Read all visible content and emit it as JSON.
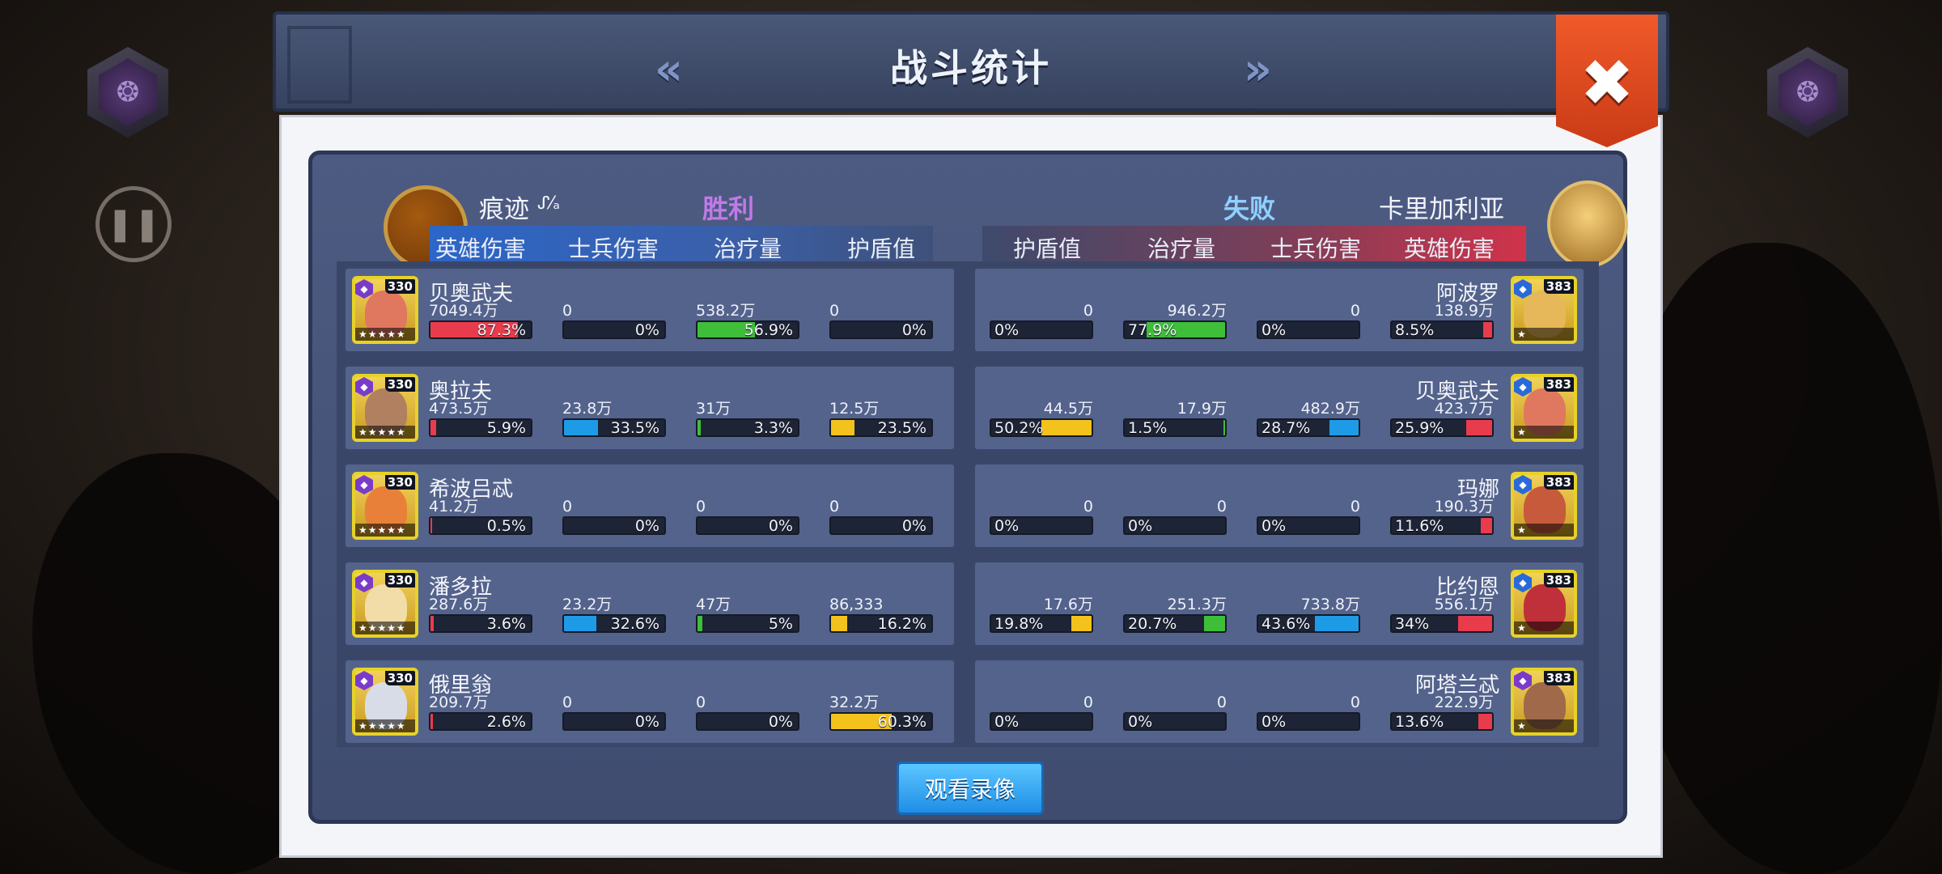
{
  "title": "战斗统计",
  "nav": {
    "prev_icon": "«",
    "next_icon": "»",
    "close_icon": "✖"
  },
  "left_side": {
    "player": "痕迹",
    "player_mark": "ᔑ⁄ₐ",
    "result": "胜利",
    "result_color": "#c07ae8",
    "columns": [
      "英雄伤害",
      "士兵伤害",
      "治疗量",
      "护盾值"
    ]
  },
  "right_side": {
    "player": "卡里加利亚",
    "result": "失败",
    "result_color": "#8fd0ff",
    "columns": [
      "护盾值",
      "治疗量",
      "士兵伤害",
      "英雄伤害"
    ]
  },
  "left_heroes": [
    {
      "name": "贝奥武夫",
      "level": "330",
      "face": "#e07860",
      "stats": [
        {
          "value": "7049.4万",
          "pct": "87.3%",
          "fill": 0.873,
          "color": "#e83c4c"
        },
        {
          "value": "0",
          "pct": "0%",
          "fill": 0,
          "color": "#1e9be6"
        },
        {
          "value": "538.2万",
          "pct": "56.9%",
          "fill": 0.569,
          "color": "#3fbe3a"
        },
        {
          "value": "0",
          "pct": "0%",
          "fill": 0,
          "color": "#f3c21c"
        }
      ]
    },
    {
      "name": "奥拉夫",
      "level": "330",
      "face": "#b08060",
      "stats": [
        {
          "value": "473.5万",
          "pct": "5.9%",
          "fill": 0.059,
          "color": "#e83c4c"
        },
        {
          "value": "23.8万",
          "pct": "33.5%",
          "fill": 0.335,
          "color": "#1e9be6"
        },
        {
          "value": "31万",
          "pct": "3.3%",
          "fill": 0.033,
          "color": "#3fbe3a"
        },
        {
          "value": "12.5万",
          "pct": "23.5%",
          "fill": 0.235,
          "color": "#f3c21c"
        }
      ]
    },
    {
      "name": "希波吕忒",
      "level": "330",
      "face": "#e8803a",
      "stats": [
        {
          "value": "41.2万",
          "pct": "0.5%",
          "fill": 0.005,
          "color": "#e83c4c"
        },
        {
          "value": "0",
          "pct": "0%",
          "fill": 0,
          "color": "#1e9be6"
        },
        {
          "value": "0",
          "pct": "0%",
          "fill": 0,
          "color": "#3fbe3a"
        },
        {
          "value": "0",
          "pct": "0%",
          "fill": 0,
          "color": "#f3c21c"
        }
      ]
    },
    {
      "name": "潘多拉",
      "level": "330",
      "face": "#f2dca8",
      "stats": [
        {
          "value": "287.6万",
          "pct": "3.6%",
          "fill": 0.036,
          "color": "#e83c4c"
        },
        {
          "value": "23.2万",
          "pct": "32.6%",
          "fill": 0.326,
          "color": "#1e9be6"
        },
        {
          "value": "47万",
          "pct": "5%",
          "fill": 0.05,
          "color": "#3fbe3a"
        },
        {
          "value": "86,333",
          "pct": "16.2%",
          "fill": 0.162,
          "color": "#f3c21c"
        }
      ]
    },
    {
      "name": "俄里翁",
      "level": "330",
      "face": "#d8dce6",
      "stats": [
        {
          "value": "209.7万",
          "pct": "2.6%",
          "fill": 0.026,
          "color": "#e83c4c"
        },
        {
          "value": "0",
          "pct": "0%",
          "fill": 0,
          "color": "#1e9be6"
        },
        {
          "value": "0",
          "pct": "0%",
          "fill": 0,
          "color": "#3fbe3a"
        },
        {
          "value": "32.2万",
          "pct": "60.3%",
          "fill": 0.603,
          "color": "#f3c21c"
        }
      ]
    }
  ],
  "right_heroes": [
    {
      "name": "阿波罗",
      "level": "383",
      "face": "#e6b85a",
      "stats": [
        {
          "value": "0",
          "pct": "0%",
          "fill": 0,
          "color": "#f3c21c"
        },
        {
          "value": "946.2万",
          "pct": "77.9%",
          "fill": 0.779,
          "color": "#3fbe3a"
        },
        {
          "value": "0",
          "pct": "0%",
          "fill": 0,
          "color": "#1e9be6"
        },
        {
          "value": "138.9万",
          "pct": "8.5%",
          "fill": 0.085,
          "color": "#e83c4c"
        }
      ]
    },
    {
      "name": "贝奥武夫",
      "level": "383",
      "face": "#e07860",
      "stats": [
        {
          "value": "44.5万",
          "pct": "50.2%",
          "fill": 0.502,
          "color": "#f3c21c"
        },
        {
          "value": "17.9万",
          "pct": "1.5%",
          "fill": 0.015,
          "color": "#3fbe3a"
        },
        {
          "value": "482.9万",
          "pct": "28.7%",
          "fill": 0.287,
          "color": "#1e9be6"
        },
        {
          "value": "423.7万",
          "pct": "25.9%",
          "fill": 0.259,
          "color": "#e83c4c"
        }
      ]
    },
    {
      "name": "玛娜",
      "level": "383",
      "face": "#c85a3c",
      "stats": [
        {
          "value": "0",
          "pct": "0%",
          "fill": 0,
          "color": "#f3c21c"
        },
        {
          "value": "0",
          "pct": "0%",
          "fill": 0,
          "color": "#3fbe3a"
        },
        {
          "value": "0",
          "pct": "0%",
          "fill": 0,
          "color": "#1e9be6"
        },
        {
          "value": "190.3万",
          "pct": "11.6%",
          "fill": 0.116,
          "color": "#e83c4c"
        }
      ]
    },
    {
      "name": "比约恩",
      "level": "383",
      "face": "#c0303a",
      "stats": [
        {
          "value": "17.6万",
          "pct": "19.8%",
          "fill": 0.198,
          "color": "#f3c21c"
        },
        {
          "value": "251.3万",
          "pct": "20.7%",
          "fill": 0.207,
          "color": "#3fbe3a"
        },
        {
          "value": "733.8万",
          "pct": "43.6%",
          "fill": 0.436,
          "color": "#1e9be6"
        },
        {
          "value": "556.1万",
          "pct": "34%",
          "fill": 0.34,
          "color": "#e83c4c"
        }
      ]
    },
    {
      "name": "阿塔兰忒",
      "level": "383",
      "face": "#a06a4a",
      "stats": [
        {
          "value": "0",
          "pct": "0%",
          "fill": 0,
          "color": "#f3c21c"
        },
        {
          "value": "0",
          "pct": "0%",
          "fill": 0,
          "color": "#3fbe3a"
        },
        {
          "value": "0",
          "pct": "0%",
          "fill": 0,
          "color": "#1e9be6"
        },
        {
          "value": "222.9万",
          "pct": "13.6%",
          "fill": 0.136,
          "color": "#e83c4c"
        }
      ]
    }
  ],
  "replay_button": "观看录像"
}
